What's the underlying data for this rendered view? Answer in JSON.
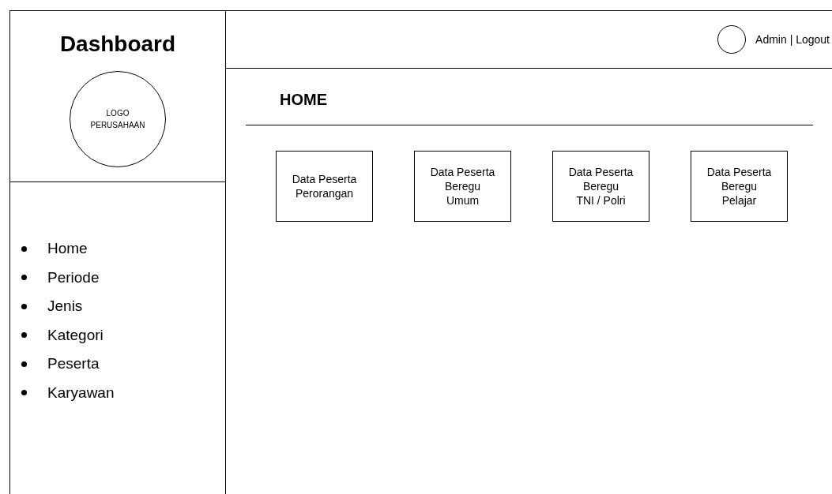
{
  "sidebar": {
    "title": "Dashboard",
    "logo_lines": [
      "LOGO",
      "PERUSAHAAN"
    ],
    "menu": [
      {
        "label": "Home"
      },
      {
        "label": "Periode"
      },
      {
        "label": "Jenis"
      },
      {
        "label": "Kategori"
      },
      {
        "label": "Peserta"
      },
      {
        "label": "Karyawan"
      }
    ]
  },
  "header": {
    "user": "Admin | Logout"
  },
  "page_title": "HOME",
  "cards": [
    {
      "lines": [
        "Data Peserta",
        "Perorangan"
      ]
    },
    {
      "lines": [
        "Data Peserta",
        "Beregu",
        "Umum"
      ]
    },
    {
      "lines": [
        "Data Peserta",
        "Beregu",
        "TNI / Polri"
      ]
    },
    {
      "lines": [
        "Data Peserta",
        "Beregu",
        "Pelajar"
      ]
    }
  ]
}
